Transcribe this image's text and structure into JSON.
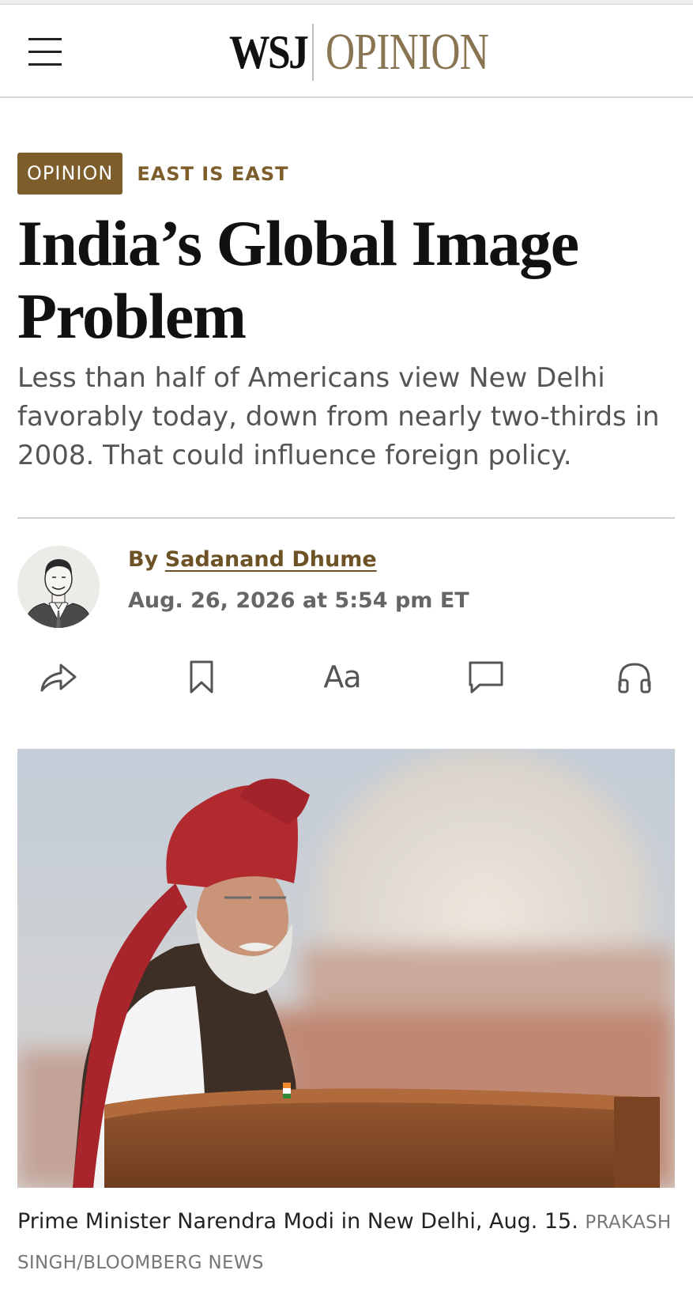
{
  "header": {
    "menu_icon": "hamburger-menu-icon",
    "brand_wsj": "WSJ",
    "brand_section": "OPINION",
    "brand_color": "#8a7553"
  },
  "article": {
    "tag": "OPINION",
    "section": "EAST IS EAST",
    "headline": "India’s Global Image Problem",
    "dek": "Less than half of Americans view New Delhi favorably today, down from nearly two-thirds in 2008. That could influence foreign policy.",
    "byline_prefix": "By",
    "author": "Sadanand Dhume",
    "date": "Aug. 26, 2026 at 5:54 pm ET",
    "accent_color": "#7d5d2a"
  },
  "toolbar": {
    "share_icon": "share-icon",
    "save_icon": "bookmark-icon",
    "text_size_label": "Aa",
    "comment_icon": "comment-icon",
    "listen_icon": "headphones-icon"
  },
  "image": {
    "caption": "Prime Minister Narendra Modi in New Delhi, Aug. 15.",
    "credit": "PRAKASH SINGH/BLOOMBERG NEWS"
  }
}
